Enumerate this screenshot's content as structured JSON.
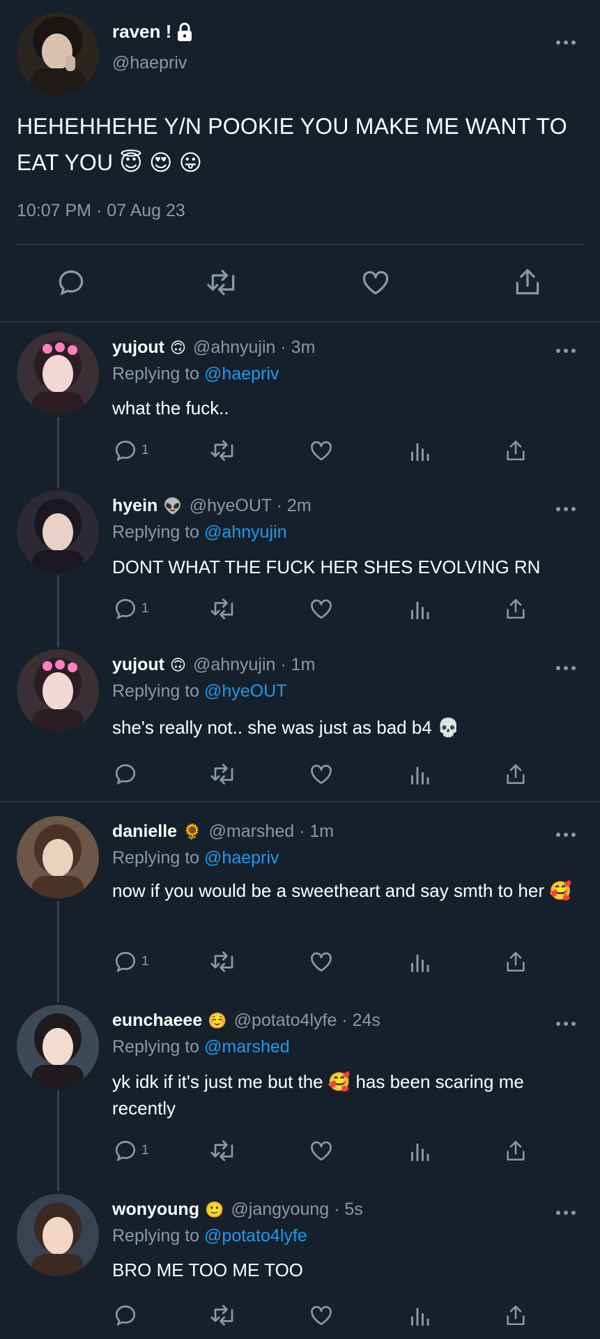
{
  "main_tweet": {
    "name": "raven !",
    "lock_icon": "lock-icon",
    "handle": "@haepriv",
    "text": "HEHEHHEHE Y/N POOKIE YOU MAKE ME WANT TO EAT YOU 😇 😍 😛",
    "timestamp": "10:07 PM · 07 Aug 23"
  },
  "replies": [
    {
      "name": "yujout",
      "emoji": "🙃",
      "handle_time": "@ahnyujin · 3m",
      "replying_prefix": "Replying to",
      "replying_to": "@haepriv",
      "text": "what the fuck..",
      "reply_count": "1"
    },
    {
      "name": "hyein",
      "emoji": "👽",
      "handle_time": "@hyeOUT · 2m",
      "replying_prefix": "Replying to",
      "replying_to": "@ahnyujin",
      "text": "DONT WHAT THE FUCK HER SHES EVOLVING RN",
      "reply_count": "1"
    },
    {
      "name": "yujout",
      "emoji": "🙃",
      "handle_time": "@ahnyujin · 1m",
      "replying_prefix": "Replying to",
      "replying_to": "@hyeOUT",
      "text": "she's really not.. she was just as bad b4 💀",
      "reply_count": ""
    },
    {
      "name": "danielle",
      "emoji": "🌻",
      "handle_time": "@marshed · 1m",
      "replying_prefix": "Replying to",
      "replying_to": "@haepriv",
      "text": "now if you would be a sweetheart and say smth to her 🥰",
      "reply_count": "1"
    },
    {
      "name": "eunchaeee",
      "emoji": "☺️",
      "handle_time": "@potato4lyfe · 24s",
      "replying_prefix": "Replying to",
      "replying_to": "@marshed",
      "text": "yk idk if it's just me but the 🥰  has been scaring me recently",
      "reply_count": "1"
    },
    {
      "name": "wonyoung",
      "emoji": "🙂",
      "handle_time": "@jangyoung · 5s",
      "replying_prefix": "Replying to",
      "replying_to": "@potato4lyfe",
      "text": "BRO ME TOO ME TOO",
      "reply_count": ""
    }
  ],
  "colors": {
    "background": "#15202b",
    "muted": "#8b98a5",
    "link": "#1d9bf0",
    "divider": "#38444d"
  }
}
